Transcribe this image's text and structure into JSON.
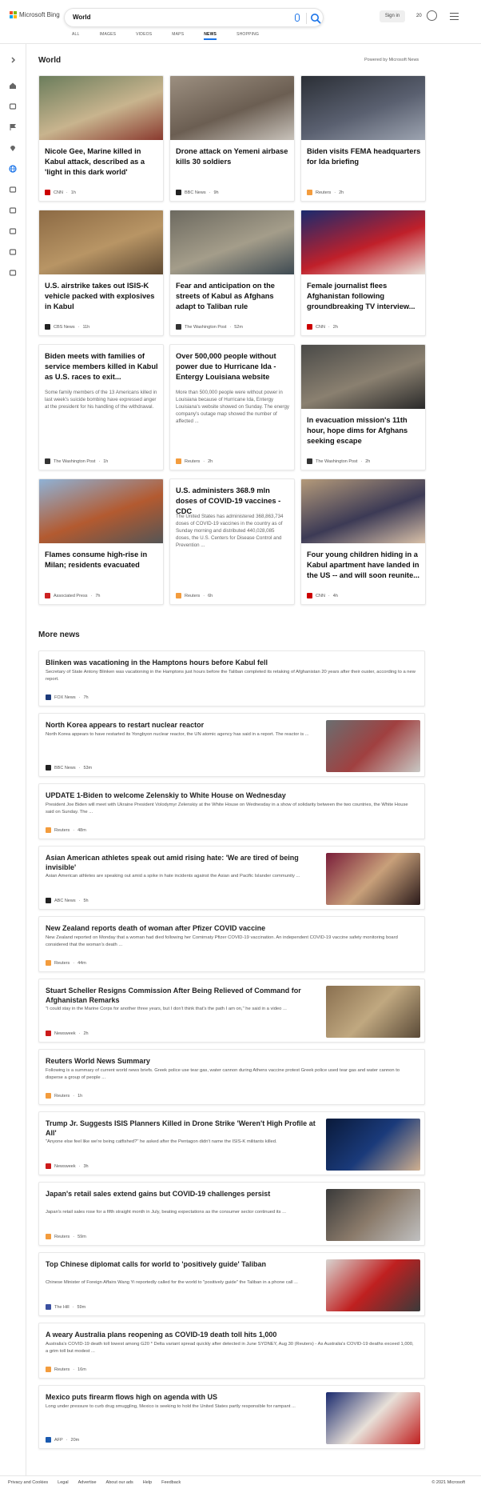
{
  "header": {
    "brand": "Microsoft Bing",
    "query": "World",
    "sign_in": "Sign in",
    "points": "20",
    "nav": [
      {
        "label": "ALL",
        "active": false
      },
      {
        "label": "IMAGES",
        "active": false
      },
      {
        "label": "VIDEOS",
        "active": false
      },
      {
        "label": "MAPS",
        "active": false
      },
      {
        "label": "NEWS",
        "active": true
      },
      {
        "label": "SHOPPING",
        "active": false
      }
    ]
  },
  "rail": {
    "icons": [
      "chevron-right-icon",
      "home-icon",
      "plane-icon",
      "flag-icon",
      "location-icon",
      "globe-icon",
      "science-icon",
      "rocket-icon",
      "film-icon",
      "bank-icon",
      "card-icon"
    ]
  },
  "world": {
    "title": "World",
    "powered": "Powered by Microsoft News",
    "cards": [
      {
        "title": "Nicole Gee, Marine killed in Kabul attack, described as a 'light in this dark world'",
        "snippet": "",
        "source": "CNN",
        "time": "1h",
        "source_color": "#cc0000",
        "img_colors": [
          "#6b7d5c",
          "#c8b48e",
          "#8a3a2f"
        ]
      },
      {
        "title": "Drone attack on Yemeni airbase kills 30 soldiers",
        "snippet": "",
        "source": "BBC News",
        "time": "9h",
        "source_color": "#222222",
        "img_colors": [
          "#9c8f80",
          "#6b5e52",
          "#c8c2ba"
        ]
      },
      {
        "title": "Biden visits FEMA headquarters for Ida briefing",
        "snippet": "",
        "source": "Reuters",
        "time": "2h",
        "source_color": "#f39c3d",
        "img_colors": [
          "#2b2f36",
          "#5a6070",
          "#9ca3b0"
        ]
      },
      {
        "title": "U.S. airstrike takes out ISIS-K vehicle packed with explosives in Kabul",
        "snippet": "",
        "source": "CBS News",
        "time": "11h",
        "source_color": "#222222",
        "img_colors": [
          "#8c6a44",
          "#b89565",
          "#5f4a33"
        ]
      },
      {
        "title": "Fear and anticipation on the streets of Kabul as Afghans adapt to Taliban rule",
        "snippet": "",
        "source": "The Washington Post",
        "time": "52m",
        "source_color": "#333333",
        "img_colors": [
          "#6d6a60",
          "#a49d8a",
          "#3e4a52"
        ]
      },
      {
        "title": "Female journalist flees Afghanistan following groundbreaking TV interview...",
        "snippet": "",
        "source": "CNN",
        "time": "2h",
        "source_color": "#cc0000",
        "img_colors": [
          "#1a2a6e",
          "#c0202a",
          "#e8e0d8"
        ]
      },
      {
        "title": "Biden meets with families of service members killed in Kabul as U.S. races to exit...",
        "snippet": "Some family members of the 13 Americans killed in last week's suicide bombing have expressed anger at the president for his handling of the withdrawal.",
        "source": "The Washington Post",
        "time": "1h",
        "source_color": "#333333",
        "img_colors": []
      },
      {
        "title": "Over 500,000 people without power due to Hurricane Ida - Entergy Louisiana website",
        "snippet": "More than 500,000 people were without power in Louisiana because of Hurricane Ida, Entergy Louisiana's website showed on Sunday. The energy company's outage map showed the number of affected ...",
        "source": "Reuters",
        "time": "2h",
        "source_color": "#f39c3d",
        "img_colors": []
      },
      {
        "title": "In evacuation mission's 11th hour, hope dims for Afghans seeking escape",
        "snippet": "",
        "source": "The Washington Post",
        "time": "2h",
        "source_color": "#333333",
        "img_colors": [
          "#4a4a48",
          "#8a8070",
          "#2a2a2a"
        ]
      },
      {
        "title": "Flames consume high-rise in Milan; residents evacuated",
        "snippet": "",
        "source": "Associated Press",
        "time": "7h",
        "source_color": "#cc2222",
        "img_colors": [
          "#8fb2d6",
          "#b35a30",
          "#555555"
        ]
      },
      {
        "title": "U.S. administers 368.9 mln doses of COVID-19 vaccines - CDC",
        "snippet": "The United States has administered 368,863,734 doses of COVID-19 vaccines in the country as of Sunday morning and distributed 440,028,085 doses, the U.S. Centers for Disease Control and Prevention ...",
        "source": "Reuters",
        "time": "6h",
        "source_color": "#f39c3d",
        "img_colors": []
      },
      {
        "title": "Four young children hiding in a Kabul apartment have landed in the US -- and will soon reunite...",
        "snippet": "",
        "source": "CNN",
        "time": "4h",
        "source_color": "#cc0000",
        "img_colors": [
          "#b49a7a",
          "#3c3a55",
          "#d8c0a8"
        ]
      }
    ]
  },
  "more": {
    "title": "More news",
    "items": [
      {
        "title": "Blinken was vacationing in the Hamptons hours before Kabul fell",
        "snippet": "Secretary of State Antony Blinken was vacationing in the Hamptons just hours before the Taliban completed its retaking of Afghanistan 20 years after their ouster, according to a new report.",
        "source": "FOX News",
        "time": "7h",
        "source_color": "#1c3a7a",
        "thumb": []
      },
      {
        "title": "North Korea appears to restart nuclear reactor",
        "snippet": "North Korea appears to have restarted its Yongbyon nuclear reactor, the UN atomic agency has said in a report. The reactor is ...",
        "source": "BBC News",
        "time": "53m",
        "source_color": "#222222",
        "thumb": [
          "#6a6e70",
          "#a04040",
          "#c8c8c4"
        ]
      },
      {
        "title": "UPDATE 1-Biden to welcome Zelenskiy to White House on Wednesday",
        "snippet": "President Joe Biden will meet with Ukraine President Volodymyr Zelenskiy at the White House on Wednesday in a show of solidarity between the two countries, the White House said on Sunday. The ...",
        "source": "Reuters",
        "time": "48m",
        "source_color": "#f39c3d",
        "thumb": []
      },
      {
        "title": "Asian American athletes speak out amid rising hate: 'We are tired of being invisible'",
        "snippet": "Asian American athletes are speaking out amid a spike in hate incidents against the Asian and Pacific Islander community ...",
        "source": "ABC News",
        "time": "5h",
        "source_color": "#222222",
        "thumb": [
          "#7a1e3a",
          "#c8a07a",
          "#2a1a1a"
        ]
      },
      {
        "title": "New Zealand reports death of woman after Pfizer COVID vaccine",
        "snippet": "New Zealand reported on Monday that a woman had died following her Comirnaty Pfizer COVID-19 vaccination. An independent COVID-19 vaccine safety monitoring board considered that the woman's death ...",
        "source": "Reuters",
        "time": "44m",
        "source_color": "#f39c3d",
        "thumb": []
      },
      {
        "title": "Stuart Scheller Resigns Commission After Being Relieved of Command for Afghanistan Remarks",
        "snippet": "\"I could stay in the Marine Corps for another three years, but I don't think that's the path I am on,\" he said in a video ...",
        "source": "Newsweek",
        "time": "2h",
        "source_color": "#cc1a1a",
        "thumb": [
          "#8a7050",
          "#c0a880",
          "#5a4a38"
        ]
      },
      {
        "title": "Reuters World News Summary",
        "snippet": "Following is a summary of current world news briefs. Greek police use tear gas, water cannon during Athens vaccine protest Greek police used tear gas and water cannon to disperse a group of people ...",
        "source": "Reuters",
        "time": "1h",
        "source_color": "#f39c3d",
        "thumb": []
      },
      {
        "title": "Trump Jr. Suggests ISIS Planners Killed in Drone Strike 'Weren't High Profile at All'",
        "snippet": "\"Anyone else feel like we're being catfished?\" he asked after the Pentagon didn't name the ISIS-K militants killed.",
        "source": "Newsweek",
        "time": "3h",
        "source_color": "#cc1a1a",
        "thumb": [
          "#0a1a3a",
          "#1a3a7a",
          "#d0b090"
        ]
      },
      {
        "title": "Japan's retail sales extend gains but COVID-19 challenges persist",
        "snippet": "Japan's retail sales rose for a fifth straight month in July, beating expectations as the consumer sector continued its ...",
        "source": "Reuters",
        "time": "59m",
        "source_color": "#f39c3d",
        "thumb": [
          "#3a3a3a",
          "#8a7a6a",
          "#c0c0c0"
        ]
      },
      {
        "title": "Top Chinese diplomat calls for world to 'positively guide' Taliban",
        "snippet": "Chinese Minister of Foreign Affairs Wang Yi reportedly called for the world to \"positively guide\" the Taliban in a phone call ...",
        "source": "The Hill",
        "time": "59m",
        "source_color": "#3a50a0",
        "thumb": [
          "#d8d4d0",
          "#c02020",
          "#3a3a3a"
        ]
      },
      {
        "title": "A weary Australia plans reopening as COVID-19 death toll hits 1,000",
        "snippet": "Australia's COVID-19 death toll lowest among G20 * Delta variant spread quickly after detected in June SYDNEY, Aug 30 (Reuters) - As Australia's COVID-19 deaths exceed 1,000, a grim toll but modest ...",
        "source": "Reuters",
        "time": "16m",
        "source_color": "#f39c3d",
        "thumb": []
      },
      {
        "title": "Mexico puts firearm flows high on agenda with US",
        "snippet": "Long under pressure to curb drug smuggling, Mexico is seeking to hold the United States partly responsible for rampant ...",
        "source": "AFP",
        "time": "20m",
        "source_color": "#1a5ab0",
        "thumb": [
          "#1a2a6e",
          "#e8e0d8",
          "#c02020"
        ]
      }
    ]
  },
  "footer": {
    "links": [
      "Privacy and Cookies",
      "Legal",
      "Advertise",
      "About our ads",
      "Help",
      "Feedback"
    ],
    "copyright": "© 2021 Microsoft"
  }
}
